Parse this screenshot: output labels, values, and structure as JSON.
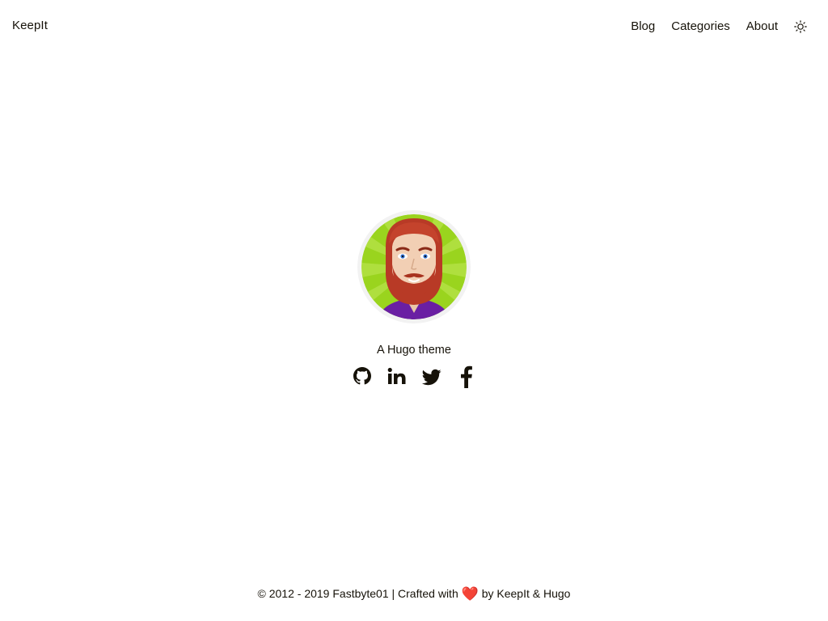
{
  "header": {
    "brand": "KeepIt",
    "nav": [
      {
        "label": "Blog"
      },
      {
        "label": "Categories"
      },
      {
        "label": "About"
      }
    ],
    "theme_toggle_icon": "sun-icon"
  },
  "profile": {
    "avatar_icon": "avatar-bearded-man",
    "subtitle": "A Hugo theme",
    "social": [
      {
        "icon": "github-icon"
      },
      {
        "icon": "linkedin-icon"
      },
      {
        "icon": "twitter-icon"
      },
      {
        "icon": "facebook-icon"
      }
    ]
  },
  "footer": {
    "copyright": "© 2012 - 2019 Fastbyte01 | Crafted with",
    "heart": "❤️",
    "by_text": "by",
    "link_keepit": "KeepIt",
    "amp": "&",
    "link_hugo": "Hugo"
  },
  "colors": {
    "text": "#161209",
    "background": "#ffffff",
    "avatar_bg": "#9ad41e",
    "avatar_ring": "#f2f2f2",
    "heart": "#e02424"
  }
}
